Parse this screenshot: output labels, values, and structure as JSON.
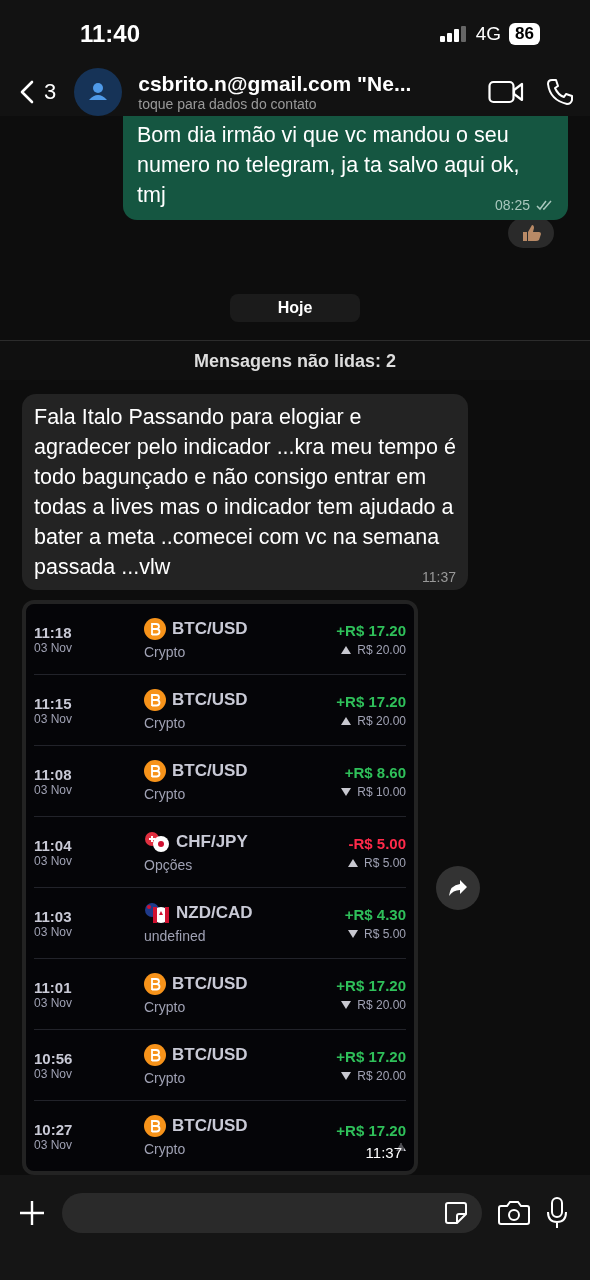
{
  "status_bar": {
    "time": "11:40",
    "network": "4G",
    "battery": "86"
  },
  "header": {
    "back_count": "3",
    "contact_name": "csbrito.n@gmail.com \"Ne...",
    "subtitle": "toque para dados do contato"
  },
  "messages": [
    {
      "kind": "outgoing",
      "text": "Bom dia irmão vi que vc mandou o seu numero no telegram, ja ta salvo aqui ok, tmj",
      "time": "08:25",
      "read": true,
      "reaction": true
    },
    {
      "kind": "date",
      "text": "Hoje"
    },
    {
      "kind": "unread",
      "text": "Mensagens não lidas: 2"
    },
    {
      "kind": "incoming",
      "text": "Fala Italo Passando para elogiar e agradecer pelo indicador ...kra meu tempo é todo bagunçado e não consigo entrar em todas a lives mas o indicador tem ajudado a bater a meta ..comecei com vc na semana passada ...vlw",
      "time": "11:37"
    },
    {
      "kind": "image",
      "time": "11:37",
      "trades": [
        {
          "kind": "crypto",
          "time": "11:18",
          "date": "03 Nov",
          "asset": "BTC/USD",
          "category": "Crypto",
          "result": "+R$ 17.20",
          "profit": true,
          "arrow_up": true,
          "stake": "R$ 20.00"
        },
        {
          "kind": "crypto",
          "time": "11:15",
          "date": "03 Nov",
          "asset": "BTC/USD",
          "category": "Crypto",
          "result": "+R$ 17.20",
          "profit": true,
          "arrow_up": true,
          "stake": "R$ 20.00"
        },
        {
          "kind": "crypto",
          "time": "11:08",
          "date": "03 Nov",
          "asset": "BTC/USD",
          "category": "Crypto",
          "result": "+R$ 8.60",
          "profit": true,
          "arrow_up": false,
          "stake": "R$ 10.00"
        },
        {
          "kind": "options",
          "time": "11:04",
          "date": "03 Nov",
          "asset": "CHF/JPY",
          "category": "Opções",
          "result": "-R$ 5.00",
          "profit": false,
          "arrow_up": true,
          "stake": "R$ 5.00"
        },
        {
          "kind": "forex",
          "time": "11:03",
          "date": "03 Nov",
          "asset": "NZD/CAD",
          "category": "undefined",
          "result": "+R$ 4.30",
          "profit": true,
          "arrow_up": false,
          "stake": "R$ 5.00"
        },
        {
          "kind": "crypto",
          "time": "11:01",
          "date": "03 Nov",
          "asset": "BTC/USD",
          "category": "Crypto",
          "result": "+R$ 17.20",
          "profit": true,
          "arrow_up": false,
          "stake": "R$ 20.00"
        },
        {
          "kind": "crypto",
          "time": "10:56",
          "date": "03 Nov",
          "asset": "BTC/USD",
          "category": "Crypto",
          "result": "+R$ 17.20",
          "profit": true,
          "arrow_up": false,
          "stake": "R$ 20.00"
        },
        {
          "kind": "crypto",
          "time": "10:27",
          "date": "03 Nov",
          "asset": "BTC/USD",
          "category": "Crypto",
          "result": "+R$ 17.20",
          "profit": true,
          "arrow_up": true
        }
      ]
    }
  ]
}
